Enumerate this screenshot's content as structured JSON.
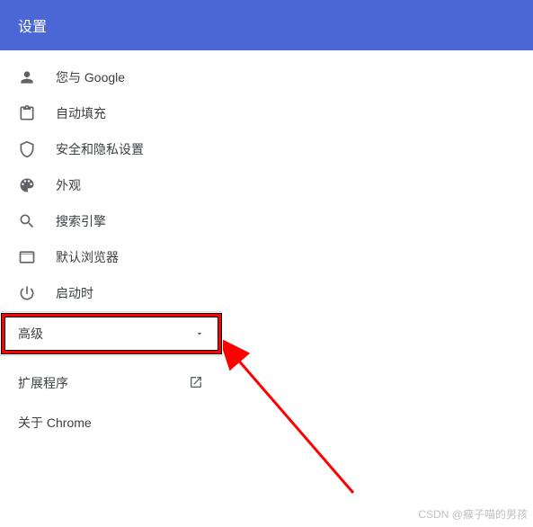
{
  "header": {
    "title": "设置"
  },
  "menu": {
    "items": [
      {
        "icon": "person-icon",
        "label": "您与 Google"
      },
      {
        "icon": "autofill-icon",
        "label": "自动填充"
      },
      {
        "icon": "security-icon",
        "label": "安全和隐私设置"
      },
      {
        "icon": "appearance-icon",
        "label": "外观"
      },
      {
        "icon": "search-icon",
        "label": "搜索引擎"
      },
      {
        "icon": "browser-icon",
        "label": "默认浏览器"
      },
      {
        "icon": "power-icon",
        "label": "启动时"
      }
    ]
  },
  "advanced": {
    "label": "高级"
  },
  "bottom": {
    "extensions": "扩展程序",
    "about": "关于 Chrome"
  },
  "watermark": "CSDN @瘊子喵的男孩"
}
